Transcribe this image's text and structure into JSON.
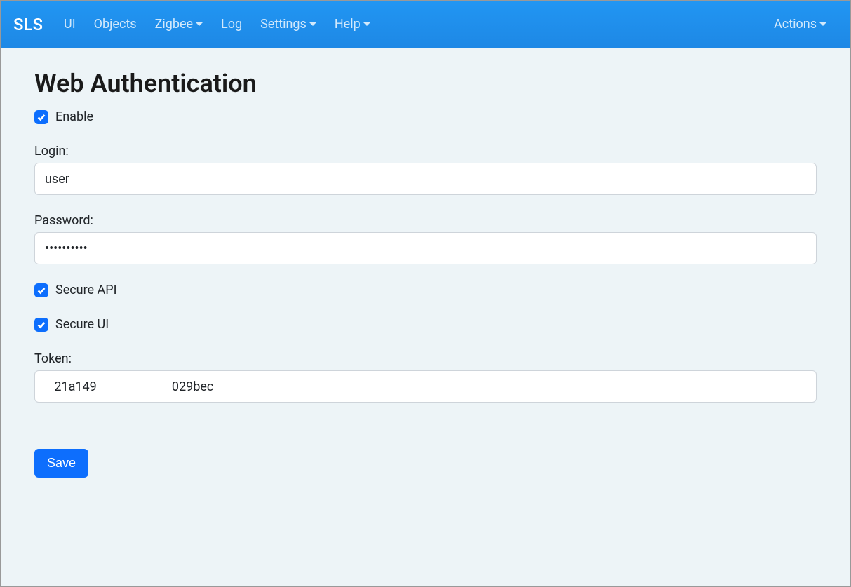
{
  "navbar": {
    "brand": "SLS",
    "items": [
      {
        "label": "UI",
        "dropdown": false
      },
      {
        "label": "Objects",
        "dropdown": false
      },
      {
        "label": "Zigbee",
        "dropdown": true
      },
      {
        "label": "Log",
        "dropdown": false
      },
      {
        "label": "Settings",
        "dropdown": true
      },
      {
        "label": "Help",
        "dropdown": true
      }
    ],
    "right": [
      {
        "label": "Actions",
        "dropdown": true
      }
    ]
  },
  "page": {
    "title": "Web Authentication",
    "enable_label": "Enable",
    "enable_checked": true,
    "login_label": "Login:",
    "login_value": "user",
    "password_label": "Password:",
    "password_value": "••••••••••",
    "secure_api_label": "Secure API",
    "secure_api_checked": true,
    "secure_ui_label": "Secure UI",
    "secure_ui_checked": true,
    "token_label": "Token:",
    "token_value": "   21a149                        029bec",
    "save_label": "Save"
  }
}
